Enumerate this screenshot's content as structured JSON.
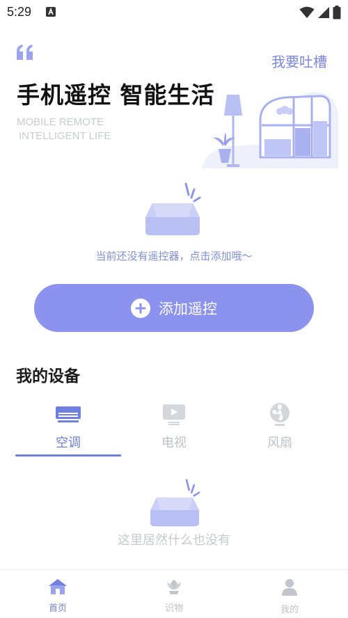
{
  "status_bar": {
    "time": "5:29"
  },
  "hero": {
    "feedback_label": "我要吐槽",
    "title": "手机遥控 智能生活",
    "subtitle_line1": "MOBILE REMOTE",
    "subtitle_line2": "INTELLIGENT LIFE"
  },
  "remote": {
    "empty_text": "当前还没有遥控器，点击添加哦～",
    "add_button_label": "添加遥控"
  },
  "devices": {
    "section_title": "我的设备",
    "tabs": [
      {
        "label": "空调",
        "icon": "air-conditioner-icon",
        "active": true
      },
      {
        "label": "电视",
        "icon": "tv-icon",
        "active": false
      },
      {
        "label": "风扇",
        "icon": "fan-icon",
        "active": false
      }
    ],
    "empty_text": "这里居然什么也没有"
  },
  "bottom_nav": [
    {
      "label": "首页",
      "icon": "home-icon",
      "active": true
    },
    {
      "label": "识物",
      "icon": "flower-icon",
      "active": false
    },
    {
      "label": "我的",
      "icon": "person-icon",
      "active": false
    }
  ],
  "colors": {
    "accent": "#8b93ee",
    "accent_dark": "#7080df",
    "inactive": "#bfc1c8"
  }
}
